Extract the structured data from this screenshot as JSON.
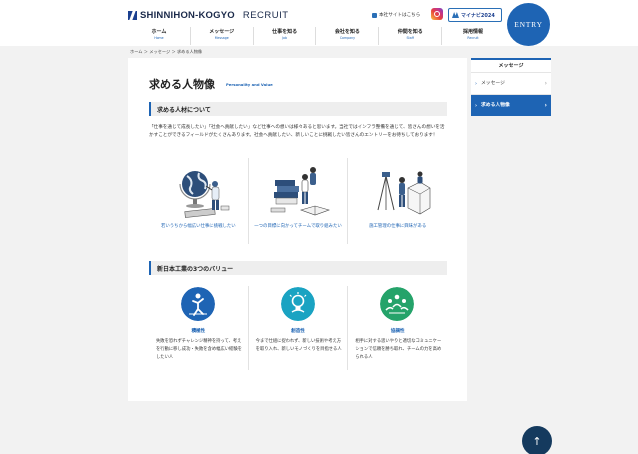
{
  "header": {
    "logo_text": "SHINNIHON-KOGYO",
    "logo_sub": "RECRUIT",
    "corp_link": "本社サイトはこちら",
    "mynavi_label": "マイナビ2024",
    "entry_label": "ENTRY"
  },
  "nav": [
    {
      "jp": "ホーム",
      "en": "Home"
    },
    {
      "jp": "メッセージ",
      "en": "Message"
    },
    {
      "jp": "仕事を知る",
      "en": "Job"
    },
    {
      "jp": "会社を知る",
      "en": "Company"
    },
    {
      "jp": "仲間を知る",
      "en": "Staff"
    },
    {
      "jp": "採用情報",
      "en": "Recruit"
    }
  ],
  "breadcrumb": "ホーム ＞ メッセージ ＞ 求める人物像",
  "page": {
    "title": "求める人物像",
    "title_en": "Personality and Value"
  },
  "section1": {
    "heading": "求める人材について",
    "intro": "「仕事を通じて成長したい」「社会へ貢献したい」など仕事への想いは様々あると思います。当社ではインフラ整備を通じて、皆さんの想いを活かすことができるフィールドがたくさんあります。社会へ貢献したい、新しいことに挑戦したい皆さんのエントリーをお待ちしております！",
    "items": [
      {
        "caption": "若いうちから幅広い仕事に挑戦したい"
      },
      {
        "caption": "一つの目標に向かってチームで取り組みたい"
      },
      {
        "caption": "施工管理の仕事に興味がある"
      }
    ]
  },
  "section2": {
    "heading": "新日本工業の3つのバリュー",
    "items": [
      {
        "name": "積極性",
        "desc": "失敗を恐れずチャレンジ精神を持って、考えを行動に移し成功・失敗を含め幅広い経験をしたい人",
        "color": "#1e64b4"
      },
      {
        "name": "創造性",
        "desc": "今まで仕組に捉われず、新しい技術や考え方を取り入れ、新しいモノづくりを目指せる人",
        "color": "#1aa3c2"
      },
      {
        "name": "協調性",
        "desc": "相手に対する思いやりと適切なコミュニケーションで信頼を勝ち取れ、チームの力を高められる人",
        "color": "#25a36a"
      }
    ]
  },
  "side": {
    "title": "メッセージ",
    "items": [
      {
        "label": "メッセージ"
      },
      {
        "label": "求める人物像"
      }
    ]
  },
  "to_top_label": "↑"
}
